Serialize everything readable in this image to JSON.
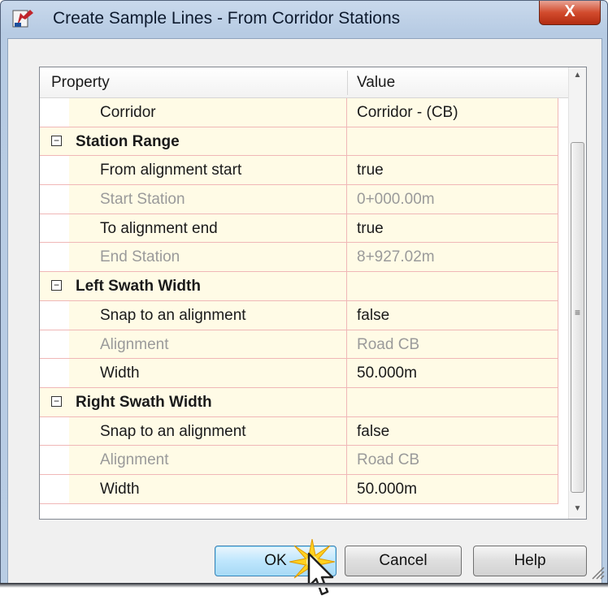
{
  "window": {
    "title": "Create Sample Lines - From Corridor Stations",
    "close_label": "X"
  },
  "grid": {
    "header": {
      "property": "Property",
      "value": "Value"
    },
    "rows": [
      {
        "kind": "item",
        "property": "Corridor",
        "value": "Corridor - (CB)",
        "disabled": false
      },
      {
        "kind": "category",
        "property": "Station Range",
        "value": "",
        "expanded": true
      },
      {
        "kind": "item",
        "property": "From alignment start",
        "value": "true",
        "disabled": false
      },
      {
        "kind": "item",
        "property": "Start Station",
        "value": "0+000.00m",
        "disabled": true
      },
      {
        "kind": "item",
        "property": "To alignment end",
        "value": "true",
        "disabled": false
      },
      {
        "kind": "item",
        "property": "End Station",
        "value": "8+927.02m",
        "disabled": true
      },
      {
        "kind": "category",
        "property": "Left Swath Width",
        "value": "",
        "expanded": true
      },
      {
        "kind": "item",
        "property": "Snap to an alignment",
        "value": "false",
        "disabled": false
      },
      {
        "kind": "item",
        "property": "Alignment",
        "value": "Road CB",
        "disabled": true
      },
      {
        "kind": "item",
        "property": "Width",
        "value": "50.000m",
        "disabled": false
      },
      {
        "kind": "category",
        "property": "Right Swath Width",
        "value": "",
        "expanded": true
      },
      {
        "kind": "item",
        "property": "Snap to an alignment",
        "value": "false",
        "disabled": false
      },
      {
        "kind": "item",
        "property": "Alignment",
        "value": "Road CB",
        "disabled": true
      },
      {
        "kind": "item",
        "property": "Width",
        "value": "50.000m",
        "disabled": false
      }
    ],
    "collapse_glyph": "−"
  },
  "buttons": {
    "ok": "OK",
    "cancel": "Cancel",
    "help": "Help"
  },
  "colors": {
    "row_background": "#fffbe6",
    "grid_line": "#f0b7b7",
    "disabled_text": "#9a9a9a",
    "close_button": "#d24b2d"
  }
}
